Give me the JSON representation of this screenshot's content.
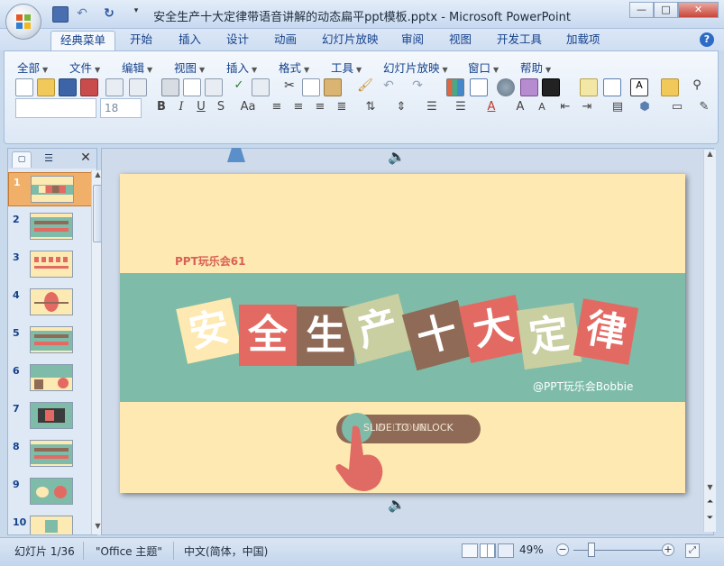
{
  "window": {
    "title": "安全生产十大定律带语音讲解的动态扁平ppt模板.pptx - Microsoft PowerPoint",
    "minimize": "—",
    "maximize": "□",
    "close": "✕"
  },
  "tabs": [
    "经典菜单",
    "开始",
    "插入",
    "设计",
    "动画",
    "幻灯片放映",
    "审阅",
    "视图",
    "开发工具",
    "加载项"
  ],
  "active_tab": "经典菜单",
  "menus": [
    "全部",
    "文件",
    "编辑",
    "视图",
    "插入",
    "格式",
    "工具",
    "幻灯片放映",
    "窗口",
    "帮助"
  ],
  "toolbar": {
    "font_name": "",
    "font_size": "18"
  },
  "thumbnails": [
    "1",
    "2",
    "3",
    "4",
    "5",
    "6",
    "7",
    "8",
    "9",
    "10"
  ],
  "selected_thumbnail": "1",
  "slide": {
    "top_label": "PPT玩乐会61",
    "title_chars": [
      "安",
      "全",
      "生",
      "产",
      "十",
      "大",
      "定",
      "律"
    ],
    "author": "@PPT玩乐会Bobbie",
    "button_text": "SLIDE TO UNLOCK",
    "button_overlay_text": "WELCOME"
  },
  "colors": {
    "slide_bg": "#fde9b1",
    "band": "#7ebca9",
    "tile_cream": "#fde9b1",
    "tile_red": "#e36a63",
    "tile_brown": "#8f6a56",
    "tile_sage": "#c9cfa1",
    "button": "#8f6a56",
    "hand": "#e06b64",
    "label_red": "#d96055"
  },
  "status": {
    "slide_info": "幻灯片 1/36",
    "theme": "\"Office 主题\"",
    "language": "中文(简体，中国)",
    "zoom": "49%"
  }
}
